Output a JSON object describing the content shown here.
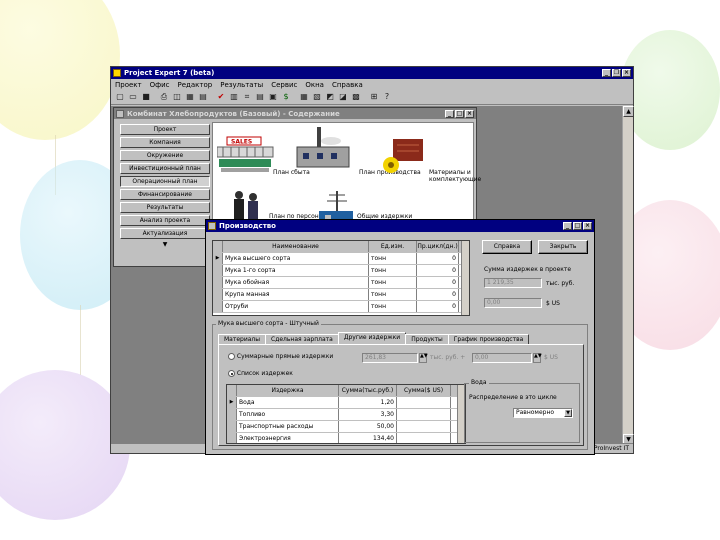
{
  "app": {
    "title": "Project Expert 7 (beta)",
    "menu": [
      "Проект",
      "Офис",
      "Редактор",
      "Результаты",
      "Сервис",
      "Окна",
      "Справка"
    ],
    "status_brand": "© ProInvest IT"
  },
  "company_window": {
    "title": "Комбинат Хлебопродуктов (Базовый) - Содержание",
    "nav_items": [
      "Проект",
      "Компания",
      "Окружение",
      "Инвестиционный план",
      "Операционный план",
      "Финансирование",
      "Результаты",
      "Анализ проекта",
      "Актуализация"
    ],
    "active_nav_index": 4,
    "modules": {
      "sales_plan": "План сбыта",
      "production_plan": "План производства",
      "materials": "Материалы и комплектующие",
      "personnel_plan": "План по персоналу",
      "overheads": "Общие издержки",
      "sales_sign": "SALES"
    }
  },
  "dialog": {
    "title": "Производство",
    "grid_headers": [
      "Наименование",
      "Ед.изм.",
      "Пр.цикл(дн.)"
    ],
    "products": [
      {
        "name": "Мука высшего сорта",
        "unit": "тонн",
        "cycle": "0"
      },
      {
        "name": "Мука 1-го сорта",
        "unit": "тонн",
        "cycle": "0"
      },
      {
        "name": "Мука обойная",
        "unit": "тонн",
        "cycle": "0"
      },
      {
        "name": "Крупа манная",
        "unit": "тонн",
        "cycle": "0"
      },
      {
        "name": "Отруби",
        "unit": "тонн",
        "cycle": "0"
      }
    ],
    "help_button": "Справка",
    "close_button": "Закрыть",
    "sum_label": "Сумма издержек в проекте",
    "sum_value": "1 219,35",
    "sum_unit": "тыс. руб.",
    "usd_value": "0,00",
    "usd_unit": "$ US",
    "group_title": "Мука высшего сорта - Штучный",
    "tabs": [
      "Материалы",
      "Сдельная зарплата",
      "Другие издержки",
      "Продукты",
      "График производства"
    ],
    "active_tab_index": 2,
    "radio_summary_label": "Суммарные прямые издержки",
    "radio_summary_value": "261,83",
    "radio_summary_value2": "0,00",
    "radio_summary_unit": "тыс. руб. +",
    "radio_summary_unit2": "$ US",
    "radio_list_label": "Список издержек",
    "cost_headers": [
      "Издержка",
      "Сумма(тыс.руб.)",
      "Сумма($ US)"
    ],
    "costs": [
      {
        "name": "Вода",
        "rub": "1,20",
        "usd": ""
      },
      {
        "name": "Топливо",
        "rub": "3,30",
        "usd": ""
      },
      {
        "name": "Транспортные расходы",
        "rub": "50,00",
        "usd": ""
      },
      {
        "name": "Электроэнергия",
        "rub": "134,40",
        "usd": ""
      }
    ],
    "value_group_label": "Вода",
    "allocation_label": "Распределение в это цикле",
    "allocation_value": "Равномерно"
  },
  "toolbar_icons": [
    "new-icon",
    "open-icon",
    "save-icon",
    "print-icon",
    "preview-icon",
    "check-icon",
    "chart-icon",
    "table-icon",
    "report-icon",
    "settings-icon",
    "help-icon"
  ]
}
